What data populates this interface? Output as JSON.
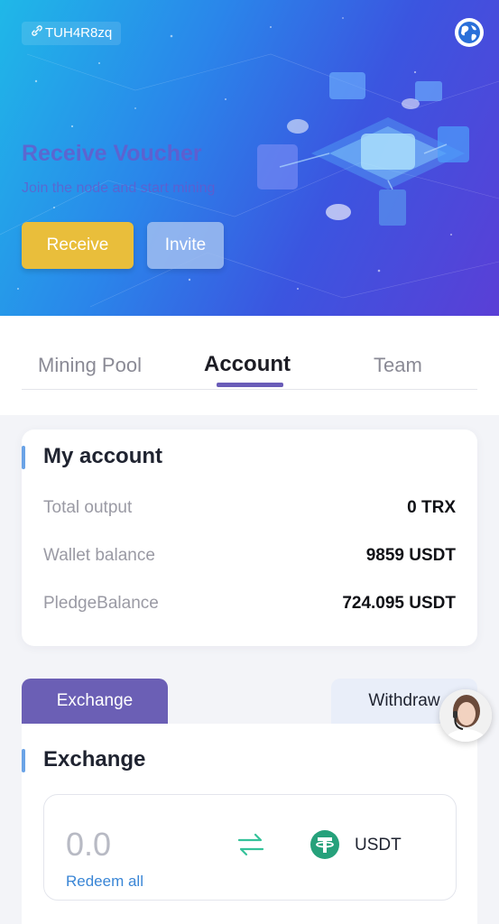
{
  "header": {
    "invite_code": "TUH4R8zq",
    "title": "Receive Voucher",
    "subtitle": "Join the node and start mining",
    "receive_label": "Receive",
    "invite_label": "Invite"
  },
  "tabs": [
    {
      "label": "Mining Pool",
      "active": false
    },
    {
      "label": "Account",
      "active": true
    },
    {
      "label": "Team",
      "active": false
    }
  ],
  "account": {
    "title": "My account",
    "rows": [
      {
        "label": "Total output",
        "value": "0 TRX"
      },
      {
        "label": "Wallet balance",
        "value": "9859 USDT"
      },
      {
        "label": "PledgeBalance",
        "value": "724.095 USDT"
      }
    ]
  },
  "panel_tabs": {
    "exchange_label": "Exchange",
    "withdraw_label": "Withdraw"
  },
  "exchange": {
    "title": "Exchange",
    "amount": "0.0",
    "redeem_all_label": "Redeem all",
    "currency": "USDT"
  },
  "colors": {
    "accent": "#6b5fb5",
    "receive": "#e9be3b",
    "usdt": "#26a17b",
    "link": "#3a86d6"
  },
  "icons": [
    "link-icon",
    "globe-icon",
    "swap-icon",
    "usdt-icon",
    "support-avatar"
  ]
}
